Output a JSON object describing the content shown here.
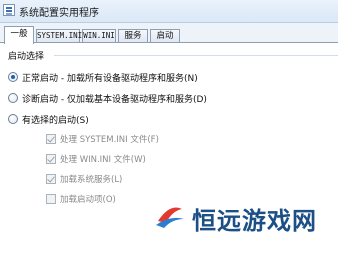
{
  "window": {
    "title": "系统配置实用程序"
  },
  "tabs": [
    {
      "label": "一般",
      "active": true
    },
    {
      "label": "SYSTEM.INI",
      "active": false
    },
    {
      "label": "WIN.INI",
      "active": false
    },
    {
      "label": "服务",
      "active": false
    },
    {
      "label": "启动",
      "active": false
    }
  ],
  "startup_selection": {
    "group_label": "启动选择",
    "options": [
      {
        "label": "正常启动 - 加载所有设备驱动程序和服务(N)",
        "selected": true
      },
      {
        "label": "诊断启动 - 仅加载基本设备驱动程序和服务(D)",
        "selected": false
      },
      {
        "label": "有选择的启动(S)",
        "selected": false
      }
    ],
    "selective_items": [
      {
        "label": "处理 SYSTEM.INI 文件(F)",
        "checked": true,
        "enabled": false
      },
      {
        "label": "处理 WIN.INI 文件(W)",
        "checked": true,
        "enabled": false
      },
      {
        "label": "加载系统服务(L)",
        "checked": true,
        "enabled": false
      },
      {
        "label": "加载启动项(O)",
        "checked": false,
        "enabled": false
      }
    ]
  },
  "watermark": {
    "text": "恒远游戏网",
    "colors": [
      "#e23a2e",
      "#1b4f86",
      "#2a7fd1"
    ]
  }
}
